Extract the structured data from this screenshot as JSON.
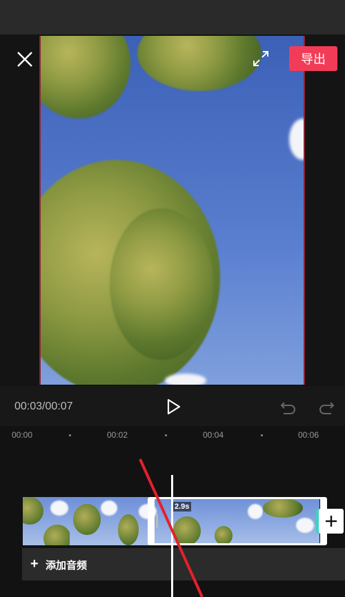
{
  "header": {
    "export_label": "导出",
    "close_icon": "close-icon",
    "fullscreen_icon": "fullscreen-icon"
  },
  "player": {
    "timecode": "00:03/00:07",
    "play_icon": "play-icon",
    "undo_icon": "undo-icon",
    "redo_icon": "redo-icon"
  },
  "ruler": {
    "ticks": [
      "00:00",
      "00:02",
      "00:04",
      "00:06"
    ]
  },
  "timeline": {
    "selected_clip_duration": "2.9s",
    "add_clip_icon": "plus-icon",
    "add_audio_label": "添加音频",
    "add_audio_icon": "plus-icon"
  },
  "colors": {
    "accent": "#f23c57",
    "annotation": "#e5202b",
    "selection_handle": "#3fd0c4",
    "background": "#121212"
  }
}
